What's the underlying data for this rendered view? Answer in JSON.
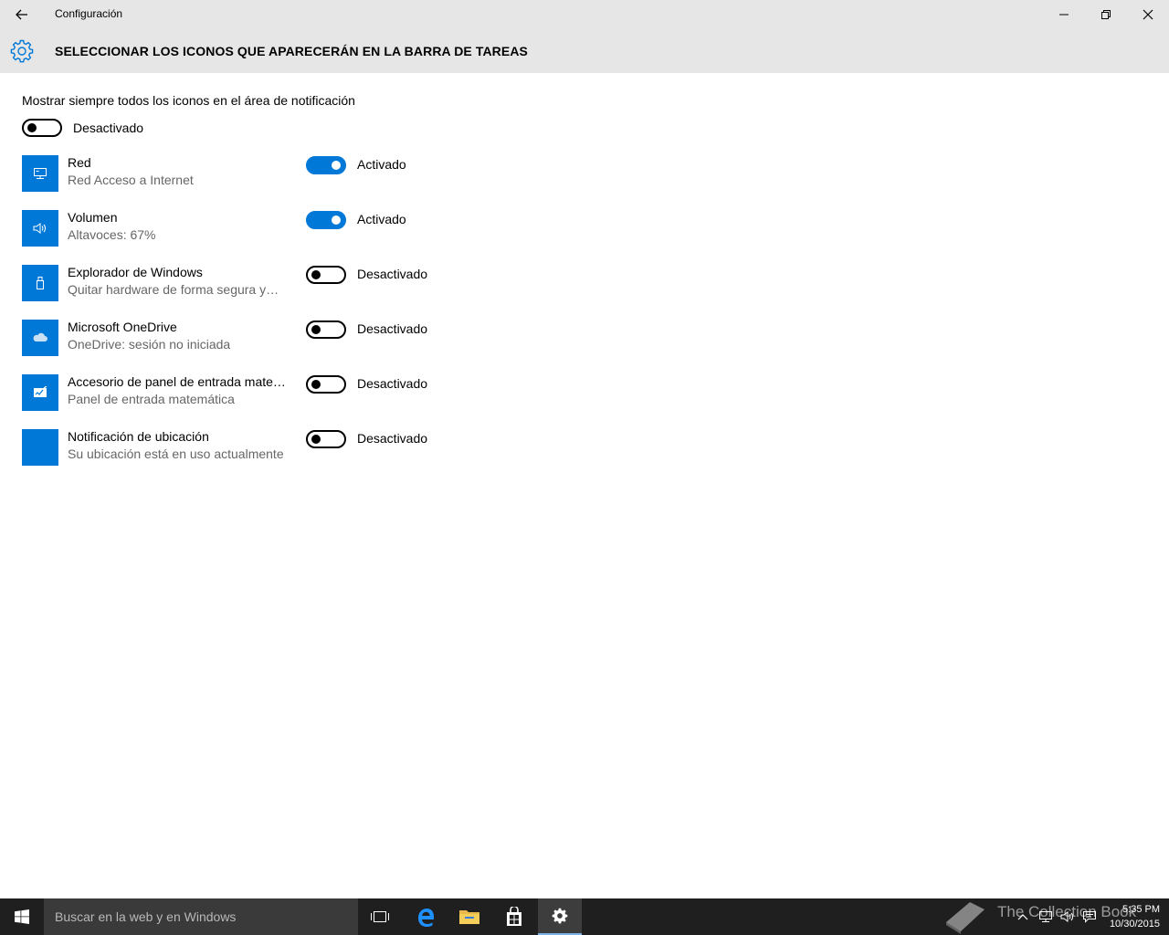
{
  "window": {
    "title": "Configuración",
    "heading": "SELECCIONAR LOS ICONOS QUE APARECERÁN EN LA BARRA DE TAREAS"
  },
  "always_show": {
    "label": "Mostrar siempre todos los iconos en el área de notificación",
    "state": "Desactivado",
    "on": false
  },
  "items": [
    {
      "name": "Red",
      "description": "Red Acceso a Internet",
      "state": "Activado",
      "on": true,
      "icon": "network-icon"
    },
    {
      "name": "Volumen",
      "description": "Altavoces: 67%",
      "state": "Activado",
      "on": true,
      "icon": "volume-icon"
    },
    {
      "name": "Explorador de Windows",
      "description": "Quitar hardware de forma segura y…",
      "state": "Desactivado",
      "on": false,
      "icon": "usb-eject-icon"
    },
    {
      "name": "Microsoft OneDrive",
      "description": "OneDrive: sesión no iniciada",
      "state": "Desactivado",
      "on": false,
      "icon": "onedrive-cloud-icon"
    },
    {
      "name": "Accesorio de panel de entrada mate…",
      "description": "Panel de entrada matemática",
      "state": "Desactivado",
      "on": false,
      "icon": "math-input-panel-icon"
    },
    {
      "name": "Notificación de ubicación",
      "description": "Su ubicación está en uso actualmente",
      "state": "Desactivado",
      "on": false,
      "icon": "location-icon"
    }
  ],
  "taskbar": {
    "search_placeholder": "Buscar en la web y en Windows",
    "time": "5:35 PM",
    "date": "10/30/2015",
    "watermark": "The Collection Book"
  },
  "colors": {
    "accent": "#0078d7",
    "titlebar": "#e6e6e6",
    "taskbar": "#1f1f1f"
  }
}
